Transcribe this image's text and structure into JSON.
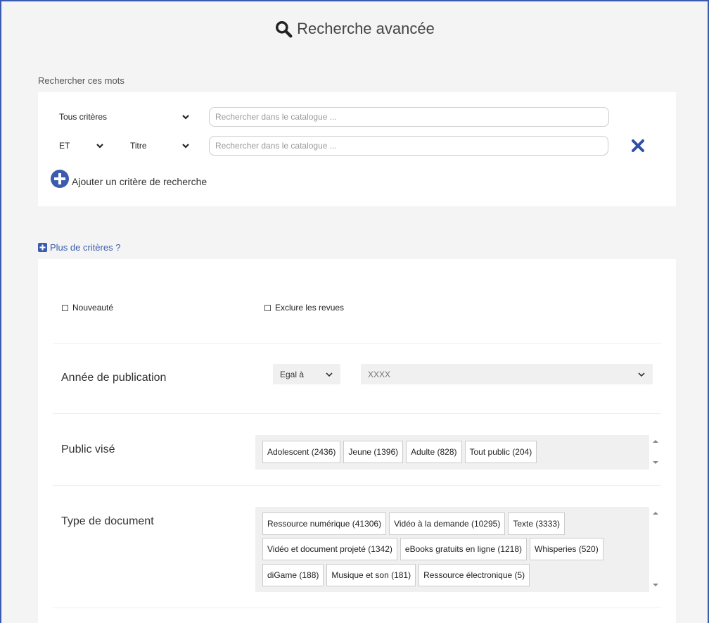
{
  "header": {
    "title": "Recherche avancée",
    "icon": "search-icon"
  },
  "search_words": {
    "label": "Rechercher ces mots",
    "rows": [
      {
        "field": "Tous critères",
        "placeholder": "Rechercher dans le catalogue ..."
      },
      {
        "operator": "ET",
        "field": "Titre",
        "placeholder": "Rechercher dans le catalogue ..."
      }
    ],
    "add_label": "Ajouter un critère de recherche"
  },
  "more_criteria": {
    "label": "Plus de critères ?",
    "checkboxes": {
      "new": "Nouveauté",
      "exclude": "Exclure les revues"
    },
    "year": {
      "label": "Année de publication",
      "operator": "Egal à",
      "value": "XXXX"
    },
    "audience": {
      "label": "Public visé",
      "chips": [
        "Adolescent (2436)",
        "Jeune (1396)",
        "Adulte (828)",
        "Tout public (204)"
      ]
    },
    "doc_type": {
      "label": "Type de document",
      "chips": [
        "Ressource numérique (41306)",
        "Vidéo à la demande (10295)",
        "Texte (3333)",
        "Vidéo et document projeté (1342)",
        "eBooks gratuits en ligne (1218)",
        "Whisperies (520)",
        "diGame (188)",
        "Musique et son (181)",
        "Ressource électronique (5)"
      ]
    }
  },
  "colors": {
    "accent": "#3b5cae",
    "cross": "#2f4fa8"
  }
}
